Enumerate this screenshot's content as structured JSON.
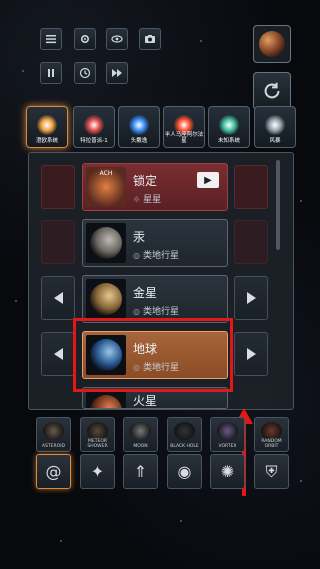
{
  "categories": [
    {
      "label": "澄欧系统",
      "icon": "orange-star-icon",
      "color": "#f0a040",
      "active": true
    },
    {
      "label": "特拉普派-1",
      "icon": "red-star-icon",
      "color": "#e04a4a",
      "active": false
    },
    {
      "label": "头戴逸",
      "icon": "blue-star-icon",
      "color": "#3a8cff",
      "active": false
    },
    {
      "label": "半人马座阿尔法星",
      "icon": "red-orange-star-icon",
      "color": "#ff5030",
      "active": false
    },
    {
      "label": "未知系统",
      "icon": "teal-nebula-icon",
      "color": "#40c0a0",
      "active": false
    },
    {
      "label": "风暴",
      "icon": "storm-icon",
      "color": "#9aa4ad",
      "active": false
    }
  ],
  "list": {
    "locked_card": {
      "badge": "ACH",
      "name": "锁定",
      "type": "星星",
      "play_label": "▶"
    },
    "cards": [
      {
        "name": "汞",
        "type": "类地行星"
      },
      {
        "name": "金星",
        "type": "类地行星"
      },
      {
        "name": "地球",
        "type": "类地行星"
      },
      {
        "name": "火星",
        "type": ""
      }
    ]
  },
  "bottom_row1": [
    "ASTEROID",
    "METEOR SHOWER",
    "MOON",
    "BLACK HOLE",
    "VORTEX",
    "RANDOM ORBIT"
  ],
  "bottom_row2_icons": [
    "spiral-galaxy-icon",
    "comet-icon",
    "rocket-launch-icon",
    "ufo-icon",
    "alien-icon",
    "shield-icon"
  ],
  "toolbar": [
    "menu-icon",
    "settings-icon",
    "eye-icon",
    "camera-icon",
    "pause-icon",
    "clock-icon",
    "fast-forward-icon"
  ],
  "accent": "#e21818"
}
